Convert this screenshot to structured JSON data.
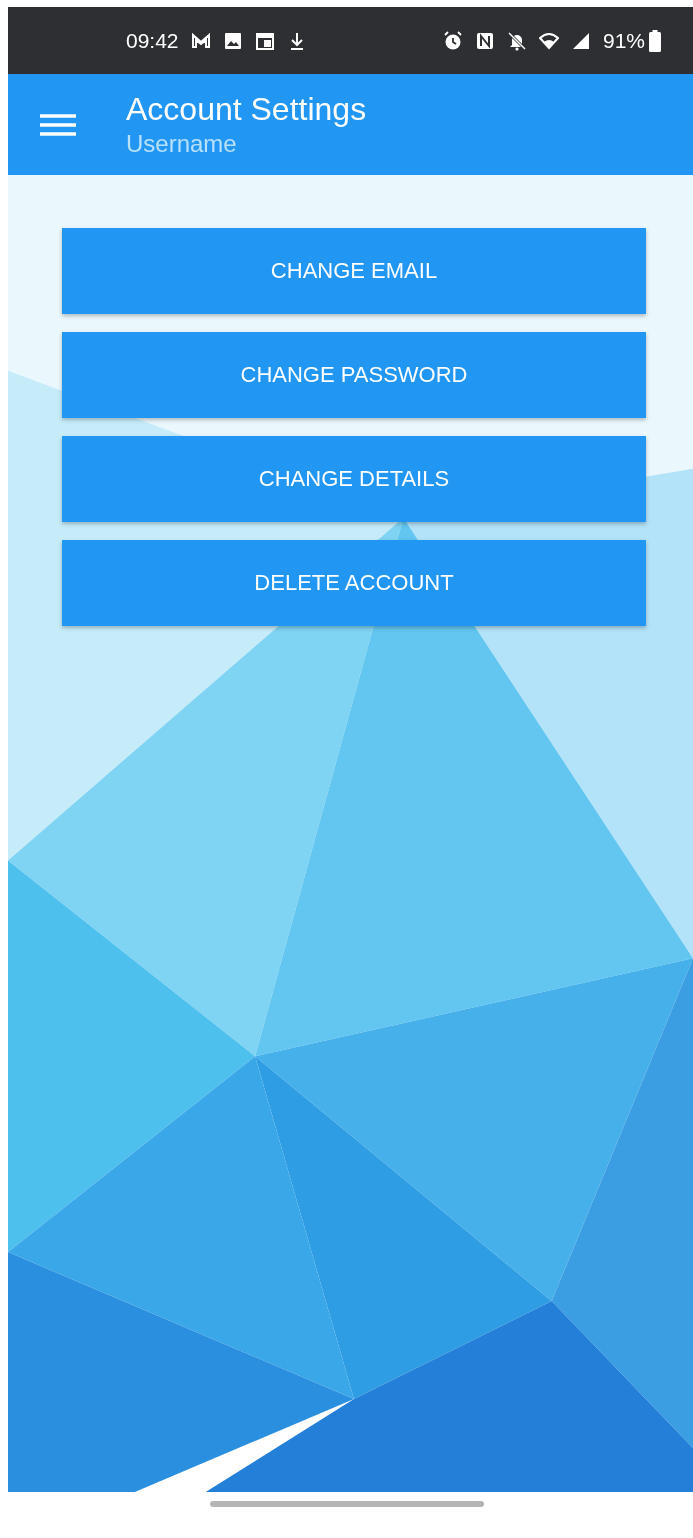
{
  "status_bar": {
    "time": "09:42",
    "battery": "91%"
  },
  "app_bar": {
    "title": "Account Settings",
    "subtitle": "Username"
  },
  "buttons": [
    "CHANGE EMAIL",
    "CHANGE PASSWORD",
    "CHANGE DETAILS",
    "DELETE ACCOUNT"
  ]
}
